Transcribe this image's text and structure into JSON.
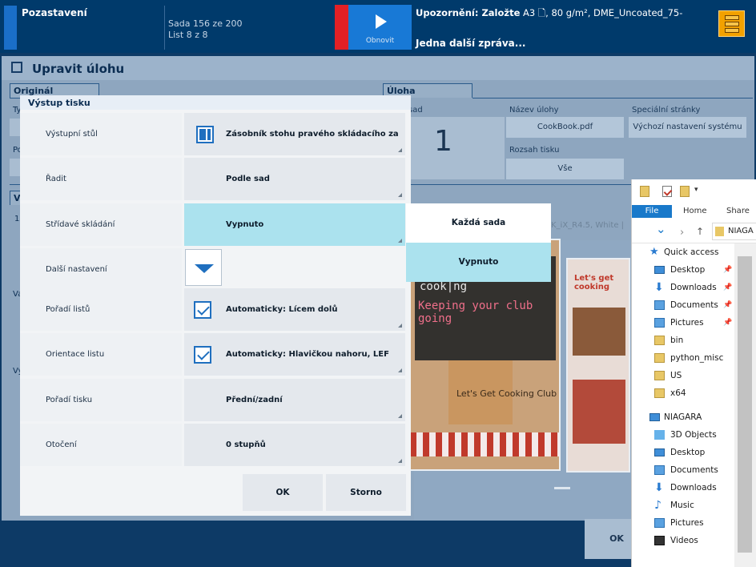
{
  "topbar": {
    "title": "Pozastavení",
    "set_line1": "Sada 156 ze 200",
    "set_line2": "List 8 z 8",
    "refresh_label": "Obnovit",
    "warning_prefix": "Upozornění: Založte",
    "warning_detail": "A3 🗋, 80 g/m², DME_Uncoated_75-",
    "more_messages": "Jedna další zpráva...",
    "alert_color": "#e32025",
    "accent_color": "#1879d6"
  },
  "background": {
    "page_title": "Upravit úlohu",
    "tab_original": "Originál",
    "tab_job": "Úloha",
    "sad_label": "sad",
    "copies_value": "1",
    "job_name_label": "Název úlohy",
    "job_name_value": "CookBook.pdf",
    "print_range_label": "Rozsah tisku",
    "print_range_value": "Vše",
    "special_pages_label": "Speciální stránky",
    "special_pages_value": "Výchozí nastavení systému",
    "side_ty": "Ty",
    "side_po": "Po",
    "side_v": "V",
    "side_1s": "1s",
    "side_va": "Va",
    "side_vy": "Vy",
    "media_strip": "K_iX_R4.5, White |",
    "ok_label": "OK",
    "cookbook_text1": "cook|ng",
    "cookbook_text2": "Keeping your club going",
    "cookbook_box": "Let's Get Cooking Club",
    "cookbook_page2": "Let's get cooking"
  },
  "dialog": {
    "title": "Výstup tisku",
    "rows": [
      {
        "label": "Výstupní stůl",
        "value": "Zásobník stohu pravého skládacího za..."
      },
      {
        "label": "Řadit",
        "value": "Podle sad"
      },
      {
        "label": "Střídavé skládání",
        "value": "Vypnuto"
      },
      {
        "label": "Další nastavení",
        "value": ""
      },
      {
        "label": "Pořadí listů",
        "value": "Automaticky: Lícem dolů"
      },
      {
        "label": "Orientace listu",
        "value": "Automaticky: Hlavičkou nahoru, LEF"
      },
      {
        "label": "Pořadí tisku",
        "value": "Přední/zadní"
      },
      {
        "label": "Otočení",
        "value": "0 stupňů"
      }
    ],
    "ok_label": "OK",
    "cancel_label": "Storno"
  },
  "dropdown": {
    "options": [
      "Každá sada",
      "Vypnuto"
    ],
    "selected": "Vypnuto"
  },
  "explorer": {
    "ribbon": {
      "file": "File",
      "home": "Home",
      "share": "Share"
    },
    "address": "NIAGA",
    "quick_access": "Quick access",
    "items": [
      {
        "name": "Desktop",
        "icon": "desktop-icon"
      },
      {
        "name": "Downloads",
        "icon": "download-icon"
      },
      {
        "name": "Documents",
        "icon": "documents-icon"
      },
      {
        "name": "Pictures",
        "icon": "pictures-icon"
      },
      {
        "name": "bin",
        "icon": "folder-icon"
      },
      {
        "name": "python_misc",
        "icon": "folder-icon"
      },
      {
        "name": "US",
        "icon": "folder-icon"
      },
      {
        "name": "x64",
        "icon": "folder-icon"
      }
    ],
    "this_pc": "NIAGARA",
    "pc_items": [
      {
        "name": "3D Objects",
        "icon": "cube-icon"
      },
      {
        "name": "Desktop",
        "icon": "desktop-icon"
      },
      {
        "name": "Documents",
        "icon": "documents-icon"
      },
      {
        "name": "Downloads",
        "icon": "download-icon"
      },
      {
        "name": "Music",
        "icon": "music-icon"
      },
      {
        "name": "Pictures",
        "icon": "pictures-icon"
      },
      {
        "name": "Videos",
        "icon": "videos-icon"
      }
    ]
  }
}
